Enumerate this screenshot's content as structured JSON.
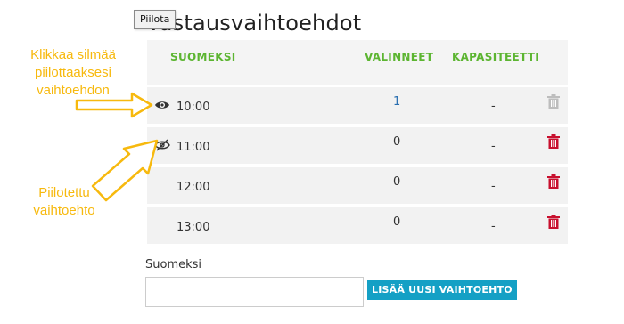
{
  "page": {
    "title": "Vastausvaihtoehdot",
    "tooltip": "Piilota"
  },
  "table": {
    "headers": {
      "name": "SUOMEKSI",
      "selected": "VALINNEET",
      "capacity": "KAPASITEETTI"
    },
    "rows": [
      {
        "time": "10:00",
        "selected": "1",
        "capacity": "-",
        "visibility_icon": "eye-icon",
        "delete_enabled": false
      },
      {
        "time": "11:00",
        "selected": "0",
        "capacity": "-",
        "visibility_icon": "eye-slash-icon",
        "delete_enabled": true
      },
      {
        "time": "12:00",
        "selected": "0",
        "capacity": "-",
        "visibility_icon": "none",
        "delete_enabled": true
      },
      {
        "time": "13:00",
        "selected": "0",
        "capacity": "-",
        "visibility_icon": "none",
        "delete_enabled": true
      }
    ]
  },
  "form": {
    "label": "Suomeksi",
    "input_value": "",
    "add_button": "LISÄÄ UUSI VAIHTOEHTO"
  },
  "annotations": {
    "top": [
      "Klikkaa silmää",
      "piilottaaksesi",
      "vaihtoehdon"
    ],
    "bottom": [
      "Piilotettu",
      "vaihtoehto"
    ]
  },
  "colors": {
    "header_text": "#5cb531",
    "row_bg": "#f2f2f2",
    "trash_active": "#c8102e",
    "trash_disabled": "#bdbdbd",
    "button_bg": "#14a0c5",
    "annotation": "#f7b90e"
  }
}
